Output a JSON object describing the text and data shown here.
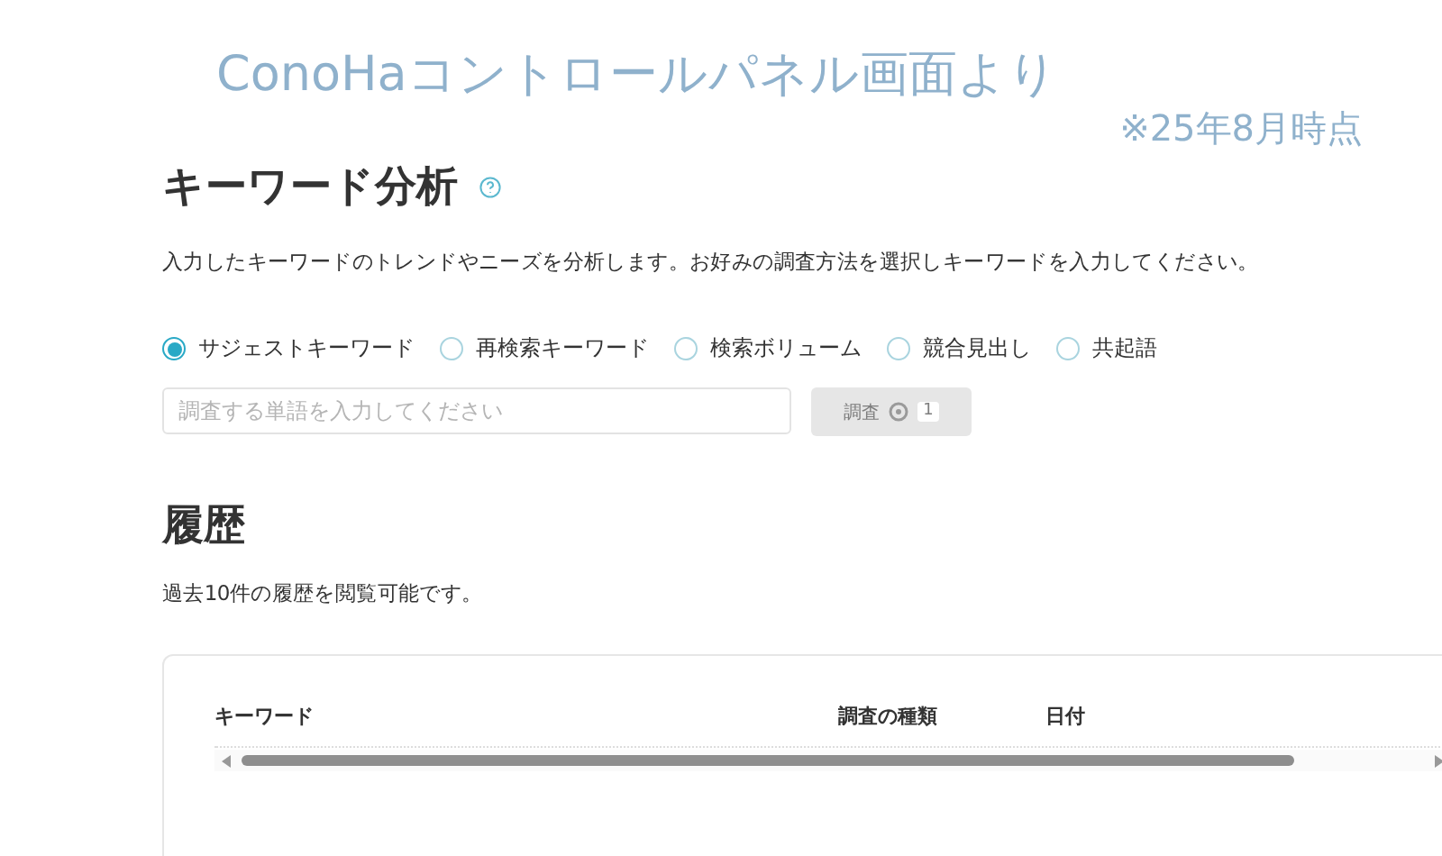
{
  "annotation": {
    "caption": "ConoHaコントロールパネル画面より",
    "date_note": "※25年8月時点"
  },
  "keyword_analysis": {
    "title": "キーワード分析",
    "description": "入力したキーワードのトレンドやニーズを分析します。お好みの調査方法を選択しキーワードを入力してください。",
    "methods": [
      {
        "label": "サジェストキーワード",
        "selected": true
      },
      {
        "label": "再検索キーワード",
        "selected": false
      },
      {
        "label": "検索ボリューム",
        "selected": false
      },
      {
        "label": "競合見出し",
        "selected": false
      },
      {
        "label": "共起語",
        "selected": false
      }
    ],
    "search": {
      "placeholder": "調査する単語を入力してください"
    },
    "submit": {
      "label": "調査",
      "count": "1",
      "disabled": true
    }
  },
  "history": {
    "title": "履歴",
    "description": "過去10件の履歴を閲覧可能です。",
    "table": {
      "columns": [
        "キーワード",
        "調査の種類",
        "日付"
      ]
    }
  }
}
